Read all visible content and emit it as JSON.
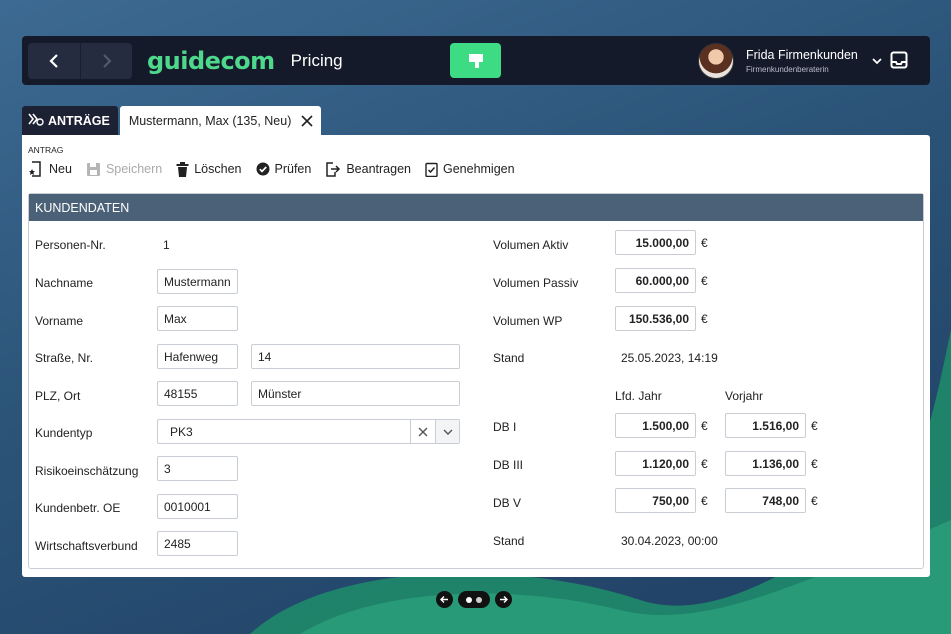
{
  "app": {
    "brand": "guidecom",
    "title": "Pricing",
    "user_name": "Frida Firmenkunden",
    "user_role": "Firmenkundenberaterin"
  },
  "tabs": {
    "antraege_label": "ANTRÄGE",
    "active_label": "Mustermann, Max (135, Neu)"
  },
  "toolbar": {
    "group_label": "ANTRAG",
    "buttons": [
      {
        "label": "Neu",
        "icon": "new-doc-icon",
        "enabled": true
      },
      {
        "label": "Speichern",
        "icon": "save-icon",
        "enabled": false
      },
      {
        "label": "Löschen",
        "icon": "trash-icon",
        "enabled": true
      },
      {
        "label": "Prüfen",
        "icon": "check-circle-icon",
        "enabled": true
      },
      {
        "label": "Beantragen",
        "icon": "submit-icon",
        "enabled": true
      },
      {
        "label": "Genehmigen",
        "icon": "approve-icon",
        "enabled": true
      }
    ]
  },
  "section": {
    "title": "KUNDENDATEN"
  },
  "left": {
    "personen_nr": {
      "label": "Personen-Nr.",
      "value": "1"
    },
    "nachname": {
      "label": "Nachname",
      "value": "Mustermann"
    },
    "vorname": {
      "label": "Vorname",
      "value": "Max"
    },
    "strasse": {
      "label": "Straße, Nr.",
      "street": "Hafenweg",
      "number": "14"
    },
    "plz_ort": {
      "label": "PLZ, Ort",
      "plz": "48155",
      "ort": "Münster"
    },
    "kundentyp": {
      "label": "Kundentyp",
      "value": "PK3"
    },
    "risiko": {
      "label": "Risikoeinschätzung",
      "value": "3"
    },
    "kundenbetr": {
      "label": "Kundenbetr. OE",
      "value": "0010001"
    },
    "wirtschaft": {
      "label": "Wirtschaftsverbund",
      "value": "2485"
    }
  },
  "right": {
    "currency": "€",
    "vol_aktiv": {
      "label": "Volumen Aktiv",
      "value": "15.000,00"
    },
    "vol_passiv": {
      "label": "Volumen Passiv",
      "value": "60.000,00"
    },
    "vol_wp": {
      "label": "Volumen WP",
      "value": "150.536,00"
    },
    "stand1": {
      "label": "Stand",
      "value": "25.05.2023, 14:19"
    },
    "col_lfd": "Lfd. Jahr",
    "col_vorjahr": "Vorjahr",
    "db1": {
      "label": "DB I",
      "lfd": "1.500,00",
      "vorjahr": "1.516,00"
    },
    "db3": {
      "label": "DB III",
      "lfd": "1.120,00",
      "vorjahr": "1.136,00"
    },
    "db5": {
      "label": "DB V",
      "lfd": "750,00",
      "vorjahr": "748,00"
    },
    "stand2": {
      "label": "Stand",
      "value": "30.04.2023, 00:00"
    }
  },
  "colors": {
    "brand": "#4ed88b",
    "topbar": "#151a2b",
    "section_header": "#4b6177"
  }
}
